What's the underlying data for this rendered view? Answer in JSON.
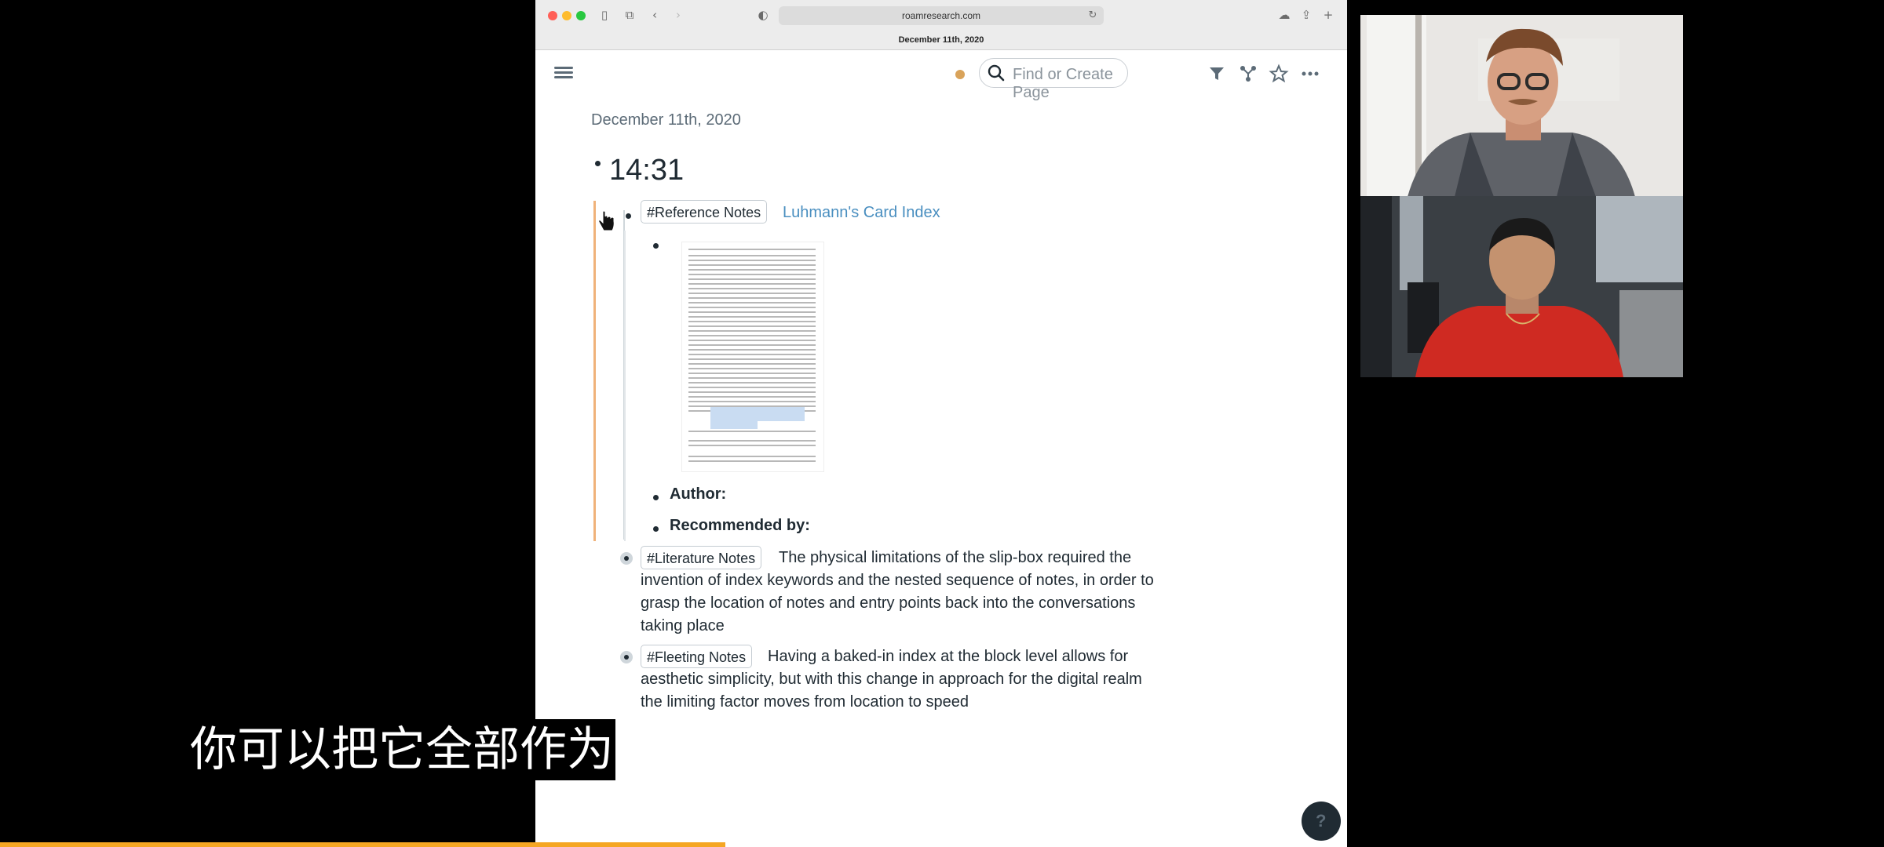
{
  "browser": {
    "url": "roamresearch.com",
    "page_tab": "December 11th, 2020"
  },
  "header": {
    "search_placeholder": "Find or Create Page"
  },
  "page": {
    "date": "December 11th, 2020",
    "time_block": "14:31",
    "reference": {
      "tag": "#Reference Notes",
      "link": "Luhmann's Card Index",
      "author_label": "Author:",
      "recommended_label": "Recommended by:"
    },
    "literature": {
      "tag": "#Literature Notes",
      "line1": "The physical limitations of the slip-box required the",
      "line2": "invention of index keywords and the nested sequence of notes, in order to",
      "line3": "grasp the location of notes and entry points back into the conversations",
      "line4": "taking place"
    },
    "fleeting": {
      "tag": "#Fleeting Notes",
      "line1": "Having a baked-in index at the block level allows for",
      "line2": "aesthetic simplicity, but with this change in approach for the digital realm",
      "line3": "the limiting factor moves from location to speed"
    }
  },
  "help_label": "?",
  "caption": "你可以把它全部作为",
  "video_progress": 0.385,
  "colors": {
    "accent_orange": "#f5a623",
    "link_blue": "#4a8fc0",
    "sync_dot": "#d9a35a",
    "thread_orange": "#f0b27a"
  }
}
